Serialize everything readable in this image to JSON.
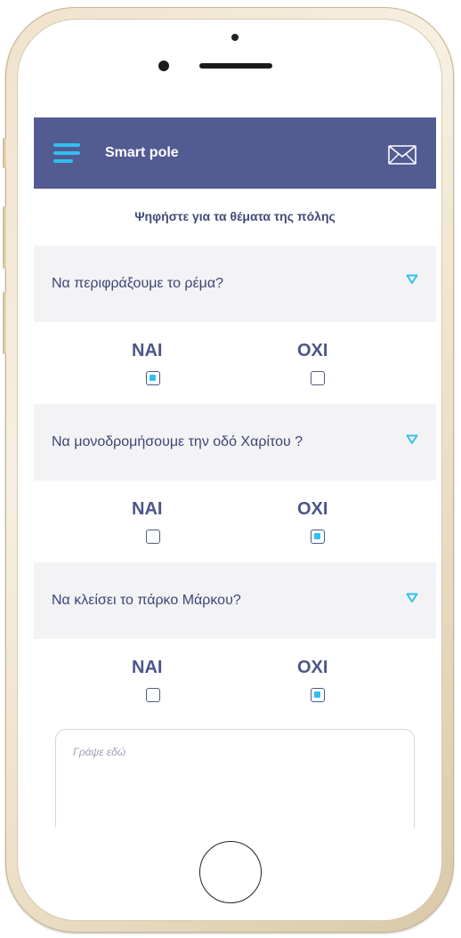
{
  "header": {
    "title": "Smart pole",
    "menu_icon": "hamburger-menu-icon",
    "mail_icon": "envelope-icon",
    "background_color": "#535b93",
    "accent_color": "#31c0f0"
  },
  "subtitle": "Ψηφήστε για τα θέματα της πόλης",
  "questions": [
    {
      "text": "Να περιφράξουμε το ρέμα?",
      "yes_label": "ΝΑΙ",
      "no_label": "ΟΧΙ",
      "selected": "yes"
    },
    {
      "text": "Να μονοδρομήσουμε την οδό Χαρίτου ?",
      "yes_label": "ΝΑΙ",
      "no_label": "ΟΧΙ",
      "selected": "no"
    },
    {
      "text": "Να κλείσει το πάρκο Μάρκου?",
      "yes_label": "ΝΑΙ",
      "no_label": "ΟΧΙ",
      "selected": "no"
    }
  ],
  "comment": {
    "placeholder": "Γράψε εδώ"
  }
}
